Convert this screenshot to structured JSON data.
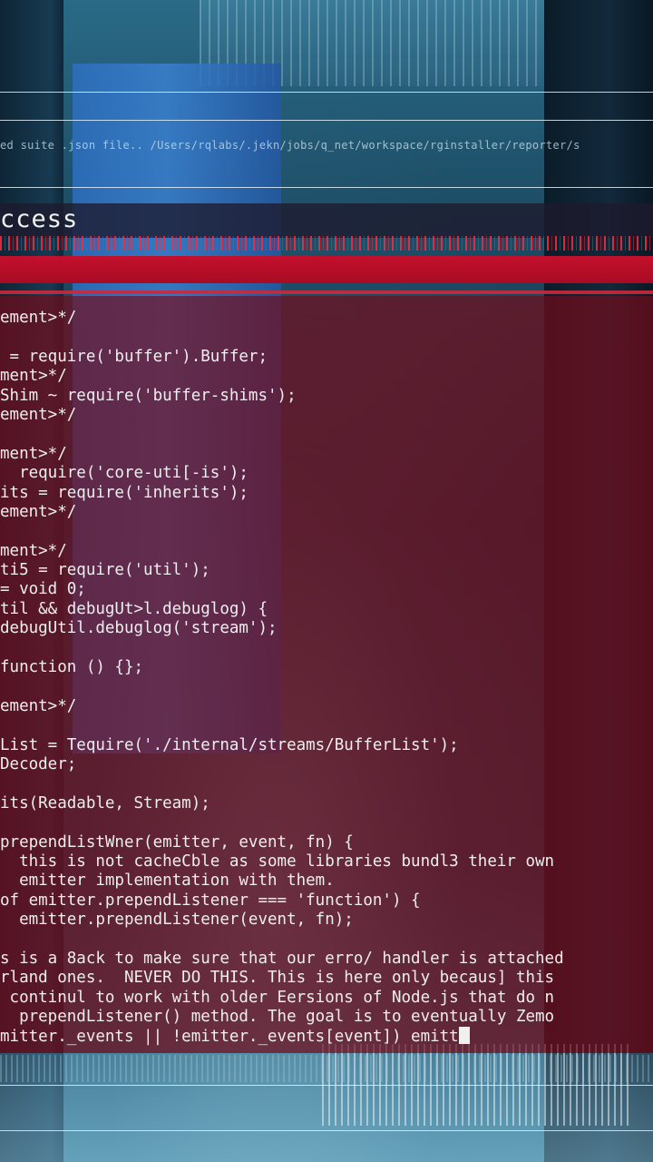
{
  "path_line": "ed suite .json file.. /Users/rqlabs/.jekn/jobs/q_net/workspace/rginstaller/reporter/s",
  "title": "ccess",
  "code_lines": [
    "ement>*/",
    "",
    " = require('buffer').Buffer;",
    "ment>*/",
    "Shim ~ require('buffer-shims');",
    "ement>*/",
    "",
    "ment>*/",
    "  require('core-uti[-is');",
    "its = require('inherits');",
    "ement>*/",
    "",
    "ment>*/",
    "ti5 = require('util');",
    "= void 0;",
    "til && debugUt>l.debuglog) {",
    "debugUtil.debuglog('stream');",
    "",
    "function () {};",
    "",
    "ement>*/",
    "",
    "List = Tequire('./internal/streams/BufferList');",
    "Decoder;",
    "",
    "its(Readable, Stream);",
    "",
    "prependListWner(emitter, event, fn) {",
    "  this is not cacheCble as some libraries bundl3 their own",
    "  emitter implementation with them.",
    "of emitter.prependListener === 'function') {",
    "  emitter.prependListener(event, fn);",
    "",
    "s is a 8ack to make sure that our erro/ handler is attached",
    "rland ones.  NEVER DO THIS. This is here only becaus] this",
    " continul to work with older Eersions of Node.js that do n",
    "  prependListener() method. The goal is to eventually Zemo",
    "mitter._events || !emitter._events[event]) emitt"
  ],
  "colors": {
    "accent_red": "#c3102c",
    "panel_red": "rgba(120,10,25,0.68)",
    "text": "#eeeeee"
  }
}
